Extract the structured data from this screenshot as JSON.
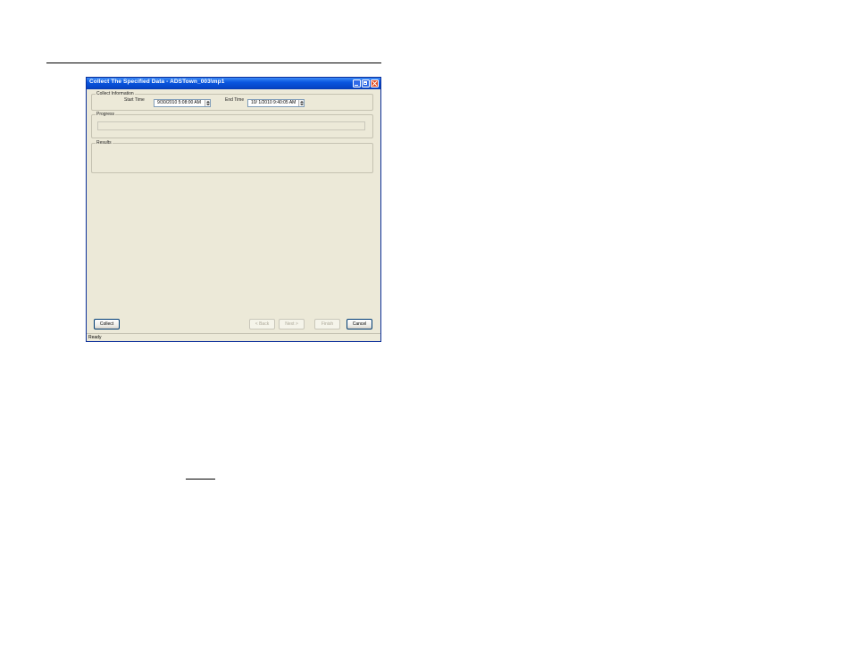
{
  "window": {
    "title": "Collect The Specified Data - ADSTown_003\\mp1"
  },
  "collect_information": {
    "group_label": "Collect Information",
    "start_time_label": "Start Time",
    "start_time_value": "9/30/2010  5:08:00 AM",
    "end_time_label": "End Time",
    "end_time_value": "10/ 1/2010  9:40:05 AM"
  },
  "progress": {
    "group_label": "Progress",
    "percent": 0
  },
  "results": {
    "group_label": "Results"
  },
  "buttons": {
    "collect": "Collect",
    "back": "< Back",
    "next": "Next >",
    "finish": "Finish",
    "cancel": "Cancel"
  },
  "status": {
    "text": "Ready"
  },
  "colors": {
    "titlebar": "#0a56e0",
    "dialog_bg": "#ece9d8",
    "close_button": "#dc4a22"
  }
}
